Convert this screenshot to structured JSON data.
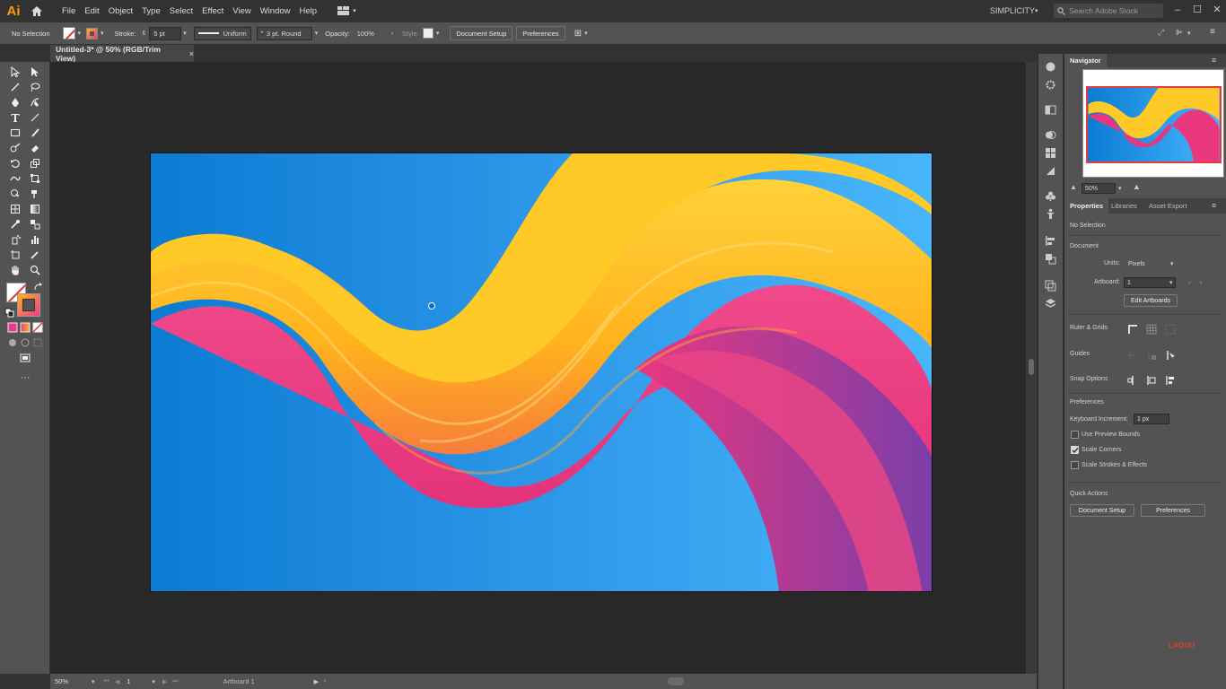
{
  "app": {
    "logo": "Ai",
    "workspace": "SIMPLICITY",
    "search_placeholder": "Search Adobe Stock"
  },
  "menu": [
    "File",
    "Edit",
    "Object",
    "Type",
    "Select",
    "Effect",
    "View",
    "Window",
    "Help"
  ],
  "control_bar": {
    "selection": "No Selection",
    "stroke_label": "Stroke:",
    "stroke_value": "5 pt",
    "stroke_profile": "Uniform",
    "brush": "3 pt. Round",
    "opacity_label": "Opacity:",
    "opacity_value": "100%",
    "style_label": "Style:",
    "document_setup": "Document Setup",
    "preferences": "Preferences"
  },
  "document_tab": {
    "title": "Untitled-3* @ 50% (RGB/Trim View)",
    "close": "×"
  },
  "status_bar": {
    "zoom": "50%",
    "artboard_num": "1",
    "artboard_name": "Artboard 1"
  },
  "navigator": {
    "title": "Navigator",
    "zoom": "50%"
  },
  "properties": {
    "tabs": [
      "Properties",
      "Libraries",
      "Asset Export"
    ],
    "selection": "No Selection",
    "document_heading": "Document",
    "units_label": "Units:",
    "units_value": "Pixels",
    "artboard_label": "Artboard:",
    "artboard_value": "1",
    "edit_artboards": "Edit Artboards",
    "ruler_grids": "Ruler & Grids",
    "guides": "Guides",
    "snap_options": "Snap Options",
    "preferences_heading": "Preferences",
    "keyboard_increment_label": "Keyboard Increment:",
    "keyboard_increment_value": "1 px",
    "use_preview_bounds": "Use Preview Bounds",
    "scale_corners": "Scale Corners",
    "scale_strokes": "Scale Strokes & Effects",
    "quick_actions": "Quick Actions",
    "qa_document_setup": "Document Setup",
    "qa_preferences": "Preferences"
  },
  "checkboxes": {
    "use_preview_bounds": false,
    "scale_corners": true,
    "scale_strokes": false
  },
  "watermark": "LADIAI",
  "colors": {
    "accent_orange": "#ff9a00",
    "artboard_blue_left": "#0b7bd3",
    "artboard_blue_right": "#48b6fb",
    "wave_yellow": "#ffc928",
    "wave_pink": "#ec3a86",
    "wave_purple": "#7a3fa8"
  },
  "icons": [
    "home-icon",
    "workspace-switcher-icon",
    "search-icon",
    "selection-tool-icon",
    "direct-selection-tool-icon",
    "pen-tool-icon",
    "type-tool-icon",
    "hand-tool-icon",
    "zoom-tool-icon"
  ]
}
